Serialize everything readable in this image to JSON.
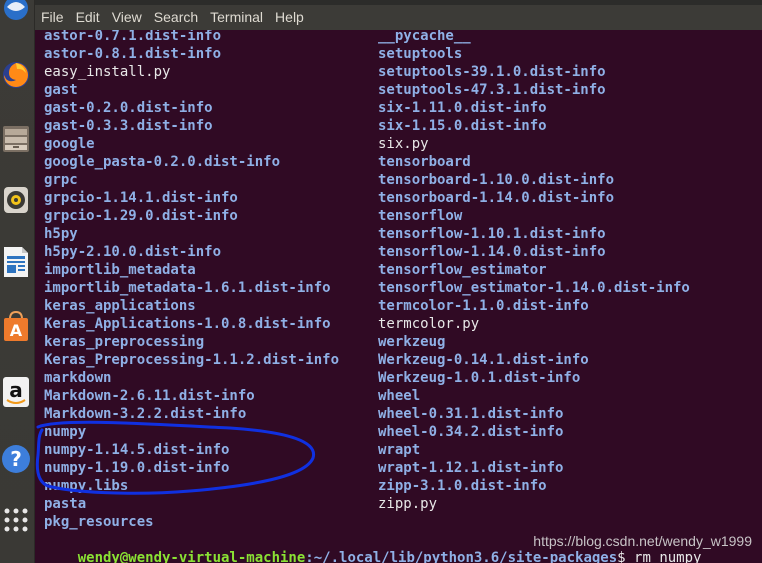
{
  "menubar": {
    "items": [
      "File",
      "Edit",
      "View",
      "Search",
      "Terminal",
      "Help"
    ]
  },
  "launcher": {
    "icons": [
      "thunderbird-icon",
      "firefox-icon",
      "files-icon",
      "rhythmbox-icon",
      "libreoffice-writer-icon",
      "software-center-icon",
      "amazon-icon",
      "help-icon",
      "app-grid-icon"
    ]
  },
  "terminal": {
    "left_column": [
      {
        "text": "astor-0.7.1.dist-info",
        "kind": "dir"
      },
      {
        "text": "astor-0.8.1.dist-info",
        "kind": "dir"
      },
      {
        "text": "easy_install.py",
        "kind": "file"
      },
      {
        "text": "gast",
        "kind": "dir"
      },
      {
        "text": "gast-0.2.0.dist-info",
        "kind": "dir"
      },
      {
        "text": "gast-0.3.3.dist-info",
        "kind": "dir"
      },
      {
        "text": "google",
        "kind": "dir"
      },
      {
        "text": "google_pasta-0.2.0.dist-info",
        "kind": "dir"
      },
      {
        "text": "grpc",
        "kind": "dir"
      },
      {
        "text": "grpcio-1.14.1.dist-info",
        "kind": "dir"
      },
      {
        "text": "grpcio-1.29.0.dist-info",
        "kind": "dir"
      },
      {
        "text": "h5py",
        "kind": "dir"
      },
      {
        "text": "h5py-2.10.0.dist-info",
        "kind": "dir"
      },
      {
        "text": "importlib_metadata",
        "kind": "dir"
      },
      {
        "text": "importlib_metadata-1.6.1.dist-info",
        "kind": "dir"
      },
      {
        "text": "keras_applications",
        "kind": "dir"
      },
      {
        "text": "Keras_Applications-1.0.8.dist-info",
        "kind": "dir"
      },
      {
        "text": "keras_preprocessing",
        "kind": "dir"
      },
      {
        "text": "Keras_Preprocessing-1.1.2.dist-info",
        "kind": "dir"
      },
      {
        "text": "markdown",
        "kind": "dir"
      },
      {
        "text": "Markdown-2.6.11.dist-info",
        "kind": "dir"
      },
      {
        "text": "Markdown-3.2.2.dist-info",
        "kind": "dir"
      },
      {
        "text": "numpy",
        "kind": "dir"
      },
      {
        "text": "numpy-1.14.5.dist-info",
        "kind": "dir"
      },
      {
        "text": "numpy-1.19.0.dist-info",
        "kind": "dir"
      },
      {
        "text": "numpy.libs",
        "kind": "dir"
      },
      {
        "text": "pasta",
        "kind": "dir"
      },
      {
        "text": "pkg_resources",
        "kind": "dir"
      }
    ],
    "right_column": [
      {
        "text": "__pycache__",
        "kind": "dir"
      },
      {
        "text": "setuptools",
        "kind": "dir"
      },
      {
        "text": "setuptools-39.1.0.dist-info",
        "kind": "dir"
      },
      {
        "text": "setuptools-47.3.1.dist-info",
        "kind": "dir"
      },
      {
        "text": "six-1.11.0.dist-info",
        "kind": "dir"
      },
      {
        "text": "six-1.15.0.dist-info",
        "kind": "dir"
      },
      {
        "text": "six.py",
        "kind": "file"
      },
      {
        "text": "tensorboard",
        "kind": "dir"
      },
      {
        "text": "tensorboard-1.10.0.dist-info",
        "kind": "dir"
      },
      {
        "text": "tensorboard-1.14.0.dist-info",
        "kind": "dir"
      },
      {
        "text": "tensorflow",
        "kind": "dir"
      },
      {
        "text": "tensorflow-1.10.1.dist-info",
        "kind": "dir"
      },
      {
        "text": "tensorflow-1.14.0.dist-info",
        "kind": "dir"
      },
      {
        "text": "tensorflow_estimator",
        "kind": "dir"
      },
      {
        "text": "tensorflow_estimator-1.14.0.dist-info",
        "kind": "dir"
      },
      {
        "text": "termcolor-1.1.0.dist-info",
        "kind": "dir"
      },
      {
        "text": "termcolor.py",
        "kind": "file"
      },
      {
        "text": "werkzeug",
        "kind": "dir"
      },
      {
        "text": "Werkzeug-0.14.1.dist-info",
        "kind": "dir"
      },
      {
        "text": "Werkzeug-1.0.1.dist-info",
        "kind": "dir"
      },
      {
        "text": "wheel",
        "kind": "dir"
      },
      {
        "text": "wheel-0.31.1.dist-info",
        "kind": "dir"
      },
      {
        "text": "wheel-0.34.2.dist-info",
        "kind": "dir"
      },
      {
        "text": "wrapt",
        "kind": "dir"
      },
      {
        "text": "wrapt-1.12.1.dist-info",
        "kind": "dir"
      },
      {
        "text": "zipp-3.1.0.dist-info",
        "kind": "dir"
      },
      {
        "text": "zipp.py",
        "kind": "file"
      }
    ],
    "prompt": {
      "user_host": "wendy@wendy-virtual-machine",
      "path": ":~/.local/lib/python3.6/site-packages",
      "command": "$ rm numpy"
    }
  },
  "watermark": "https://blog.csdn.net/wendy_w1999",
  "colors": {
    "background": "#300a24",
    "directory": "#8fb0e6",
    "file": "#e8e8e8",
    "prompt_user": "#8ae234",
    "annotation": "#1030e0"
  }
}
